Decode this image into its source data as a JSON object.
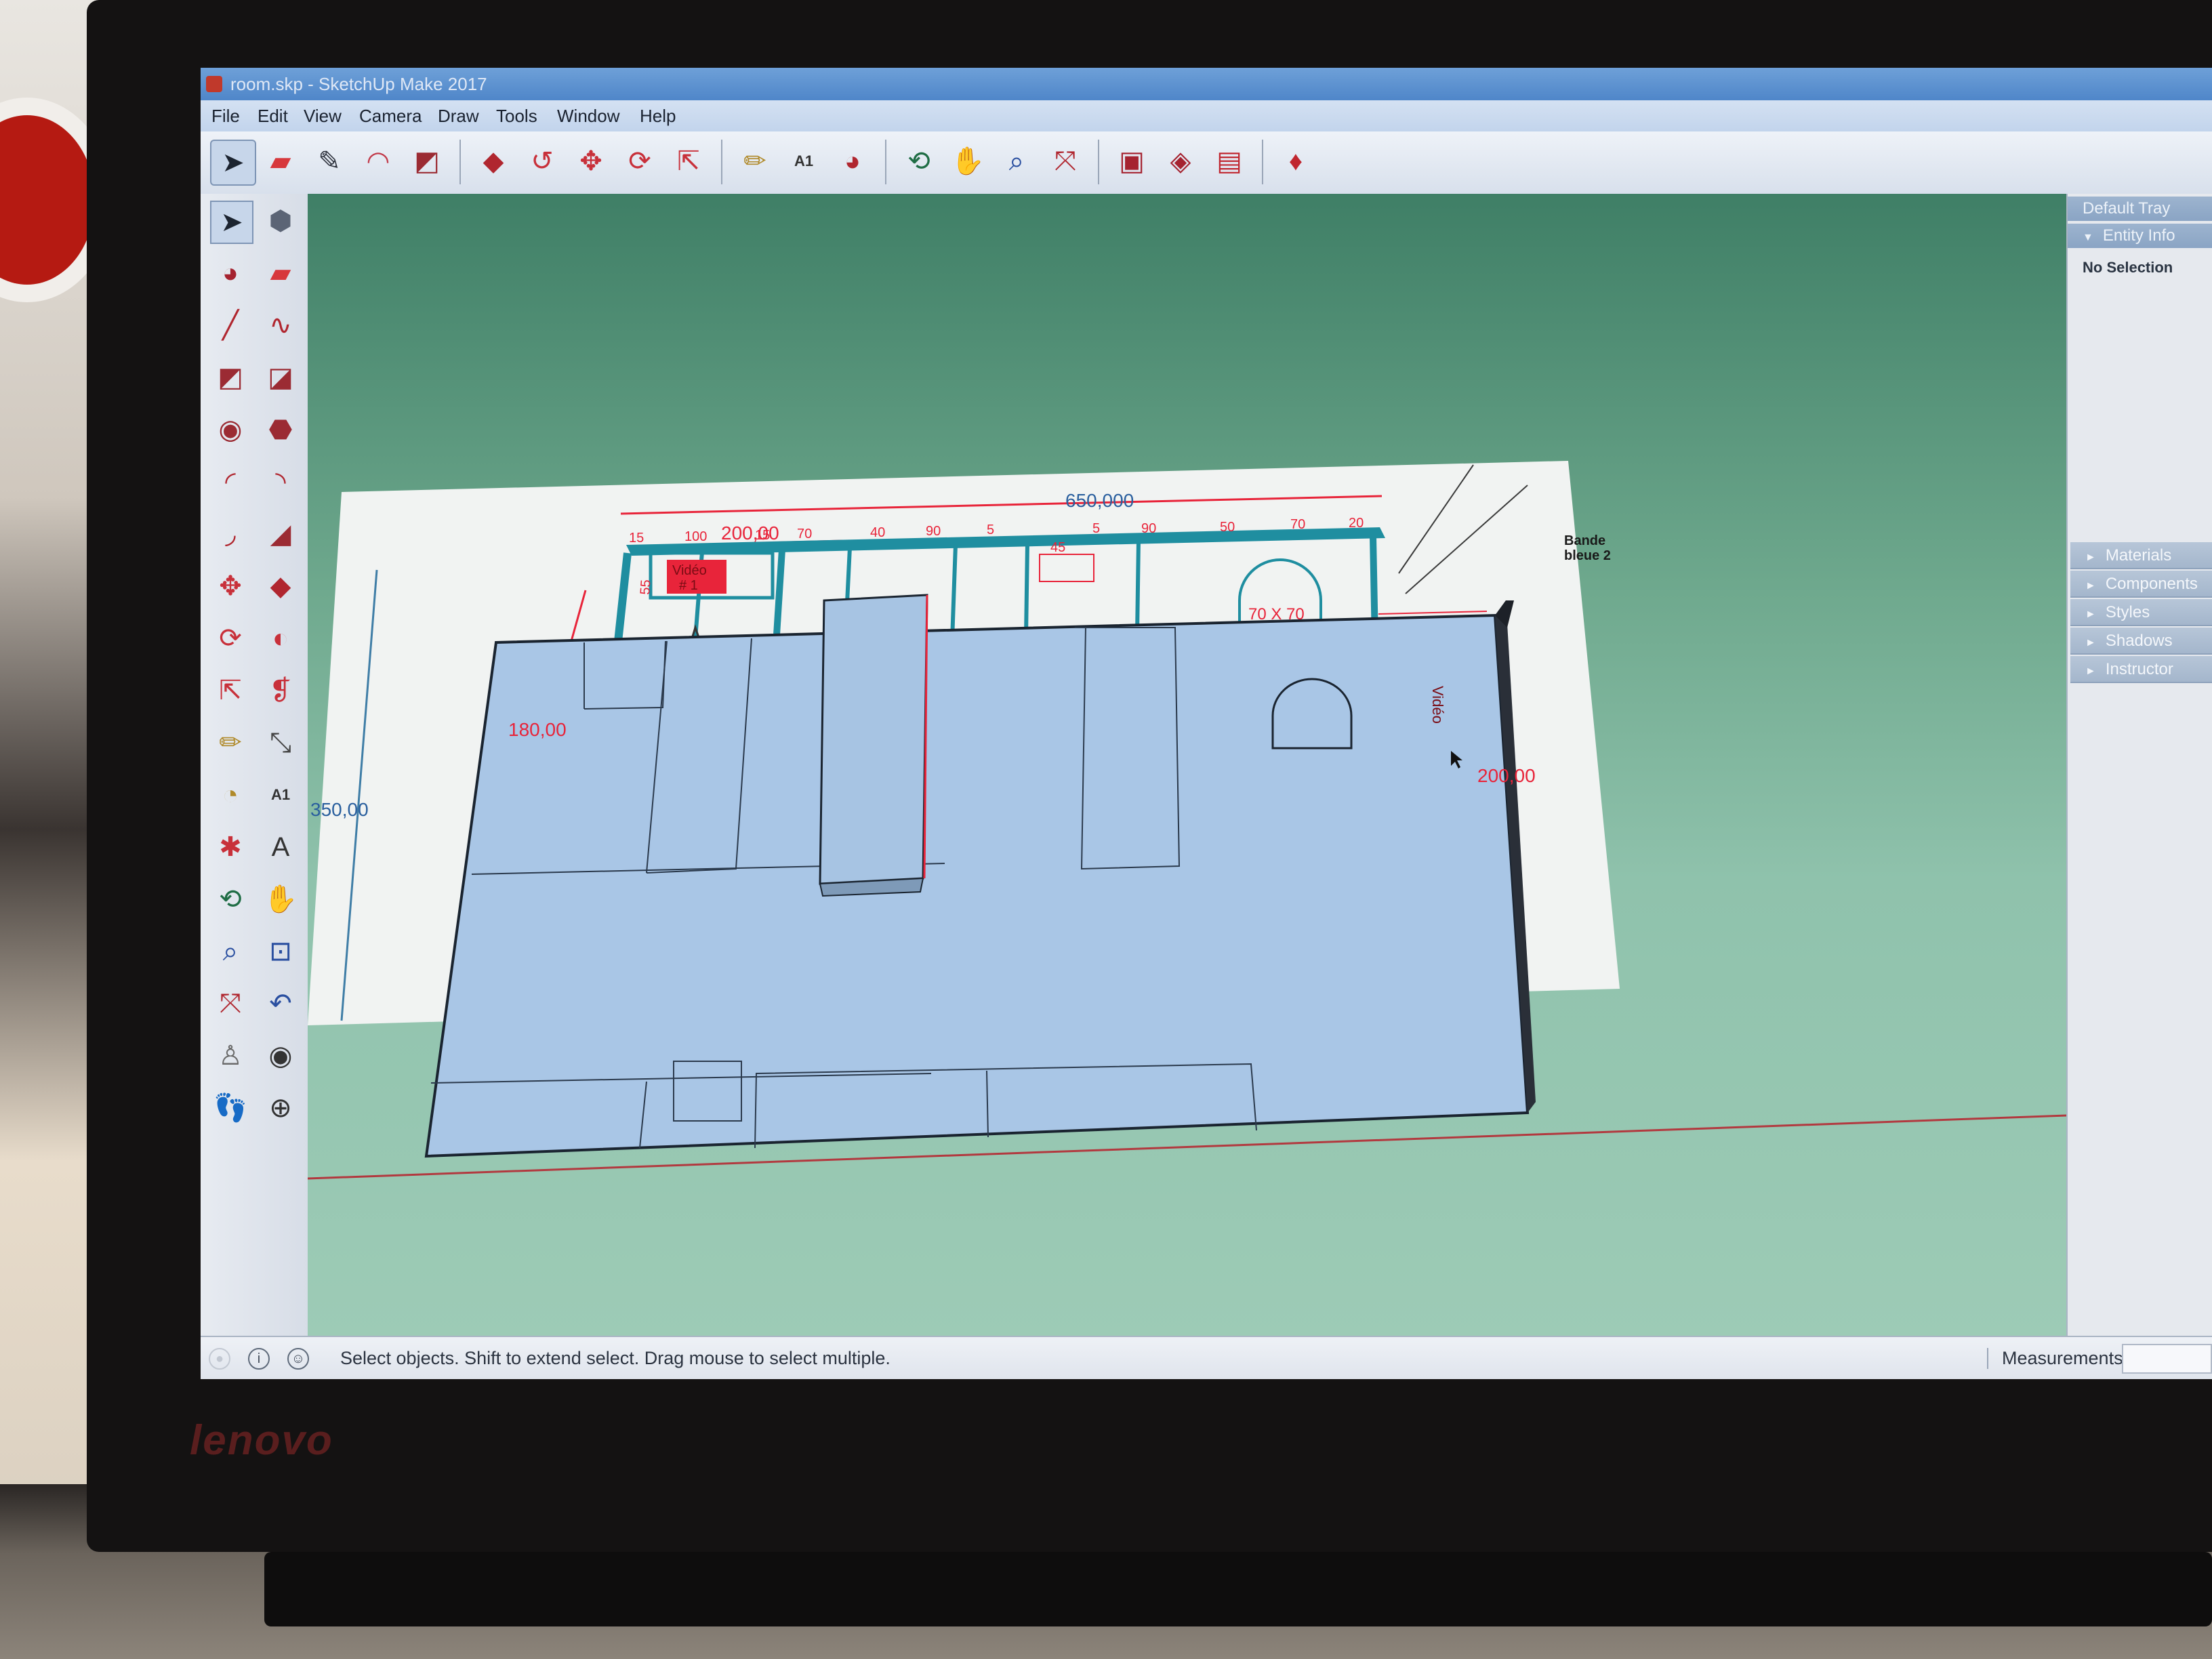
{
  "window": {
    "title": "room.skp - SketchUp Make 2017"
  },
  "menu": [
    "File",
    "Edit",
    "View",
    "Camera",
    "Draw",
    "Tools",
    "Window",
    "Help"
  ],
  "toolbar": [
    {
      "name": "select-tool",
      "icon": "➤",
      "color": "#1c2430"
    },
    {
      "name": "eraser-tool",
      "icon": "▰",
      "color": "#d7383c"
    },
    {
      "name": "line-tool",
      "icon": "✎",
      "color": "#2b2f3a"
    },
    {
      "name": "arc-tool",
      "icon": "◠",
      "color": "#c23a4a"
    },
    {
      "name": "rectangle-tool",
      "icon": "◩",
      "color": "#9b2b33"
    },
    {
      "name": "push-pull-tool",
      "icon": "◆",
      "color": "#b0262f"
    },
    {
      "name": "follow-me-tool",
      "icon": "↺",
      "color": "#c8303a"
    },
    {
      "name": "move-tool",
      "icon": "✥",
      "color": "#c8303a"
    },
    {
      "name": "rotate-tool",
      "icon": "⟳",
      "color": "#c8303a"
    },
    {
      "name": "scale-tool",
      "icon": "⇱",
      "color": "#c8303a"
    },
    {
      "name": "tape-measure-tool",
      "icon": "✏",
      "color": "#b08a2a"
    },
    {
      "name": "text-tool",
      "icon": "A1",
      "color": "#333"
    },
    {
      "name": "paint-bucket-tool",
      "icon": "◕",
      "color": "#b0262f"
    },
    {
      "name": "orbit-tool",
      "icon": "⟲",
      "color": "#1f6d45"
    },
    {
      "name": "pan-tool",
      "icon": "✋",
      "color": "#c9884a"
    },
    {
      "name": "zoom-tool",
      "icon": "⌕",
      "color": "#2a4fa0"
    },
    {
      "name": "zoom-extents-tool",
      "icon": "⤧",
      "color": "#b0262f"
    },
    {
      "name": "warehouse-tool",
      "icon": "▣",
      "color": "#a52330"
    },
    {
      "name": "extension-warehouse-tool",
      "icon": "◈",
      "color": "#a52330"
    },
    {
      "name": "layout-send-tool",
      "icon": "▤",
      "color": "#c0262f"
    },
    {
      "name": "ruby-console-tool",
      "icon": "♦",
      "color": "#c0262f"
    }
  ],
  "left_tools": [
    {
      "name": "select-tool-icon",
      "icon": "➤",
      "color": "#1c2430"
    },
    {
      "name": "component-tool-icon",
      "icon": "⬢",
      "color": "#5b6475"
    },
    {
      "name": "paint-bucket-icon",
      "icon": "◕",
      "color": "#a52330"
    },
    {
      "name": "eraser-icon",
      "icon": "▰",
      "color": "#d7383c"
    },
    {
      "name": "line-icon",
      "icon": "╱",
      "color": "#b0262f"
    },
    {
      "name": "freehand-icon",
      "icon": "∿",
      "color": "#b0262f"
    },
    {
      "name": "rectangle-icon",
      "icon": "◩",
      "color": "#9b2b33"
    },
    {
      "name": "rotated-rectangle-icon",
      "icon": "◪",
      "color": "#9b2b33"
    },
    {
      "name": "circle-icon",
      "icon": "◉",
      "color": "#9b2b33"
    },
    {
      "name": "polygon-icon",
      "icon": "⬣",
      "color": "#9b2b33"
    },
    {
      "name": "arc-icon",
      "icon": "◜",
      "color": "#b0262f"
    },
    {
      "name": "two-point-arc-icon",
      "icon": "◝",
      "color": "#b0262f"
    },
    {
      "name": "three-point-arc-icon",
      "icon": "◞",
      "color": "#b0262f"
    },
    {
      "name": "pie-icon",
      "icon": "◢",
      "color": "#9b2b33"
    },
    {
      "name": "move-icon",
      "icon": "✥",
      "color": "#c8303a"
    },
    {
      "name": "push-pull-icon",
      "icon": "◆",
      "color": "#b0262f"
    },
    {
      "name": "rotate-icon",
      "icon": "⟳",
      "color": "#c8303a"
    },
    {
      "name": "follow-me-icon",
      "icon": "◐",
      "color": "#c8303a"
    },
    {
      "name": "scale-icon",
      "icon": "⇱",
      "color": "#c8303a"
    },
    {
      "name": "offset-icon",
      "icon": "❡",
      "color": "#c8303a"
    },
    {
      "name": "tape-measure-icon",
      "icon": "✏",
      "color": "#b08a2a"
    },
    {
      "name": "dimension-icon",
      "icon": "⤡",
      "color": "#444"
    },
    {
      "name": "protractor-icon",
      "icon": "◔",
      "color": "#b08a2a"
    },
    {
      "name": "text-icon",
      "icon": "A1",
      "color": "#333"
    },
    {
      "name": "axes-icon",
      "icon": "✱",
      "color": "#c8303a"
    },
    {
      "name": "3d-text-icon",
      "icon": "A",
      "color": "#333"
    },
    {
      "name": "orbit-icon",
      "icon": "⟲",
      "color": "#1f6d45"
    },
    {
      "name": "pan-icon",
      "icon": "✋",
      "color": "#c9884a"
    },
    {
      "name": "zoom-icon",
      "icon": "⌕",
      "color": "#2a4fa0"
    },
    {
      "name": "zoom-window-icon",
      "icon": "⊡",
      "color": "#2a4fa0"
    },
    {
      "name": "zoom-extents-icon",
      "icon": "⤧",
      "color": "#b0262f"
    },
    {
      "name": "previous-view-icon",
      "icon": "↶",
      "color": "#2a4fa0"
    },
    {
      "name": "position-camera-icon",
      "icon": "♙",
      "color": "#6a6a6a"
    },
    {
      "name": "look-around-icon",
      "icon": "◉",
      "color": "#333"
    },
    {
      "name": "walk-icon",
      "icon": "👣",
      "color": "#333"
    },
    {
      "name": "section-plane-icon",
      "icon": "⊕",
      "color": "#333"
    }
  ],
  "tray": {
    "title": "Default Tray",
    "entity_info": "Entity Info",
    "selection": "No Selection",
    "panels": [
      "Materials",
      "Components",
      "Styles",
      "Shadows",
      "Instructor"
    ]
  },
  "drawing": {
    "dim_650": "650,000",
    "dim_200_top": "200,00",
    "dim_180": "180,00",
    "dim_350": "350,00",
    "dim_200_right": "200,00",
    "small_dims": [
      "15",
      "100",
      "15",
      "70",
      "40",
      "90",
      "5",
      "45",
      "5",
      "90",
      "50",
      "70",
      "20"
    ],
    "dim_55": "55",
    "video1_line1": "Vidéo",
    "video1_line2": "# 1",
    "label_70x70": "70 X 70",
    "bande_line1": "Bande",
    "bande_line2": "bleue 2",
    "video_side": "Vidéo"
  },
  "status": {
    "hint": "Select objects. Shift to extend select. Drag mouse to select multiple.",
    "measurements_label": "Measurements"
  },
  "brand": "lenovo",
  "colors": {
    "accent_red": "#e8243a",
    "teal_wall": "#1f8ea0",
    "model_blue": "#a9c6e6",
    "viewport_green": "#6fa98e"
  }
}
